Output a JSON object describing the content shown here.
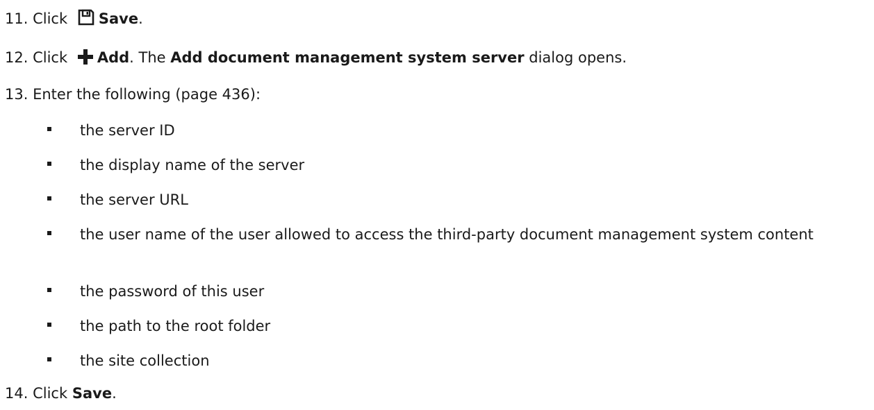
{
  "steps": [
    {
      "num": "11.",
      "pre": "Click",
      "icon": "save-icon",
      "bold": "Save",
      "post": "."
    },
    {
      "num": "12.",
      "pre": "Click",
      "icon": "plus-icon",
      "bold": "Add",
      "mid": ". The ",
      "bold2": "Add document management system server",
      "post": " dialog opens."
    },
    {
      "num": "13.",
      "text": "Enter the following (page 436):"
    },
    {
      "num": "14.",
      "pre": "Click",
      "bold": "Save",
      "post": "."
    }
  ],
  "bullets": [
    "the server ID",
    "the display name of the server",
    "the server URL",
    "the user name of the user allowed to access the third-party document management system content",
    "the password of this user",
    "the path to the root folder",
    "the site collection"
  ]
}
